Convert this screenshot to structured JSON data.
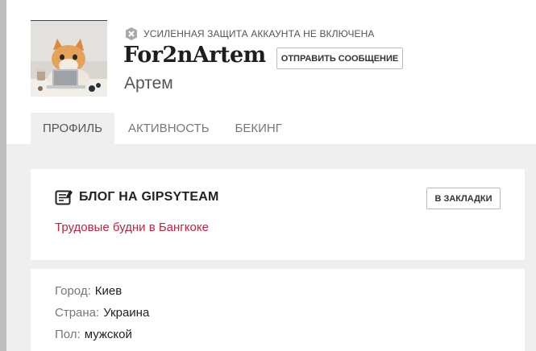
{
  "profile": {
    "security_notice": "УСИЛЕННАЯ ЗАЩИТА АККАУНТА НЕ ВКЛЮЧЕНА",
    "username": "For2nArtem",
    "real_name": "Артем",
    "send_message_label": "ОТПРАВИТЬ СООБЩЕНИЕ",
    "avatar_icon": "cat-laptop-avatar",
    "security_icon": "shield-x-icon"
  },
  "tabs": [
    {
      "label": "ПРОФИЛЬ",
      "active": true
    },
    {
      "label": "АКТИВНОСТЬ",
      "active": false
    },
    {
      "label": "БЕКИНГ",
      "active": false
    }
  ],
  "blog": {
    "title": "БЛОГ НА GIPSYTEAM",
    "bookmark_label": "В ЗАКЛАДКИ",
    "post_title": "Трудовые будни в Бангкоке",
    "icon": "blog-doc-icon",
    "link_color": "#c0233e"
  },
  "info": {
    "city_label": "Город:",
    "city": "Киев",
    "country_label": "Страна:",
    "country": "Украина",
    "gender_label": "Пол:",
    "gender": "мужской"
  }
}
